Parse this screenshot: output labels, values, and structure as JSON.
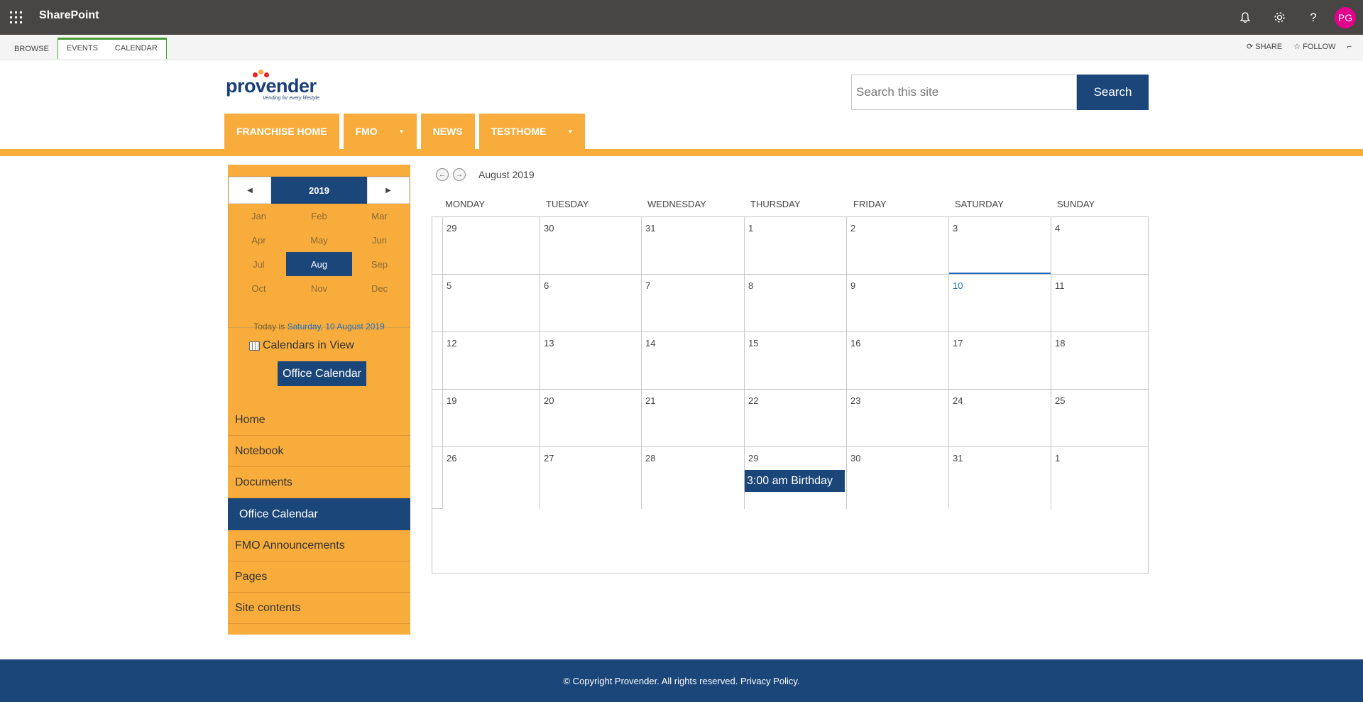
{
  "suite": {
    "brand": "SharePoint",
    "avatar_initials": "PG",
    "avatar_color": "#e3008c",
    "icons": [
      "bell-icon",
      "gear-icon",
      "help-icon"
    ]
  },
  "ribbon": {
    "browse": "BROWSE",
    "events": "EVENTS",
    "calendar": "CALENDAR",
    "share": "SHARE",
    "follow": "FOLLOW"
  },
  "logo": {
    "text": "provender",
    "tagline": "Vending for every lifestyle"
  },
  "search": {
    "placeholder": "Search this site",
    "button": "Search"
  },
  "topnav": {
    "items": [
      {
        "label": "FRANCHISE HOME"
      },
      {
        "label": "FMO"
      },
      {
        "label": "NEWS"
      },
      {
        "label": "TESTHOME"
      }
    ]
  },
  "datepicker": {
    "year": "2019",
    "months": [
      "Jan",
      "Feb",
      "Mar",
      "Apr",
      "May",
      "Jun",
      "Jul",
      "Aug",
      "Sep",
      "Oct",
      "Nov",
      "Dec"
    ],
    "selected_month": "Aug",
    "today_prefix": "Today is ",
    "today_link": "Saturday, 10 August 2019"
  },
  "calendars_in_view": {
    "label": "Calendars in View",
    "calendar_button": "Office Calendar"
  },
  "quicklaunch": {
    "items": [
      {
        "label": "Home"
      },
      {
        "label": "Notebook"
      },
      {
        "label": "Documents"
      },
      {
        "label": "Office Calendar",
        "selected": true
      },
      {
        "label": "FMO Announcements"
      },
      {
        "label": "Pages"
      },
      {
        "label": "Site contents"
      }
    ]
  },
  "calendar": {
    "month_title": "August 2019",
    "weekdays": [
      "MONDAY",
      "TUESDAY",
      "WEDNESDAY",
      "THURSDAY",
      "FRIDAY",
      "SATURDAY",
      "SUNDAY"
    ],
    "weeks": [
      [
        "29",
        "30",
        "31",
        "1",
        "2",
        "3",
        "4"
      ],
      [
        "5",
        "6",
        "7",
        "8",
        "9",
        "10",
        "11"
      ],
      [
        "12",
        "13",
        "14",
        "15",
        "16",
        "17",
        "18"
      ],
      [
        "19",
        "20",
        "21",
        "22",
        "23",
        "24",
        "25"
      ],
      [
        "26",
        "27",
        "28",
        "29",
        "30",
        "31",
        "1"
      ]
    ],
    "today": "10",
    "event": {
      "label": "3:00 am Birthday",
      "date": "29"
    }
  },
  "footer": {
    "text": "© Copyright Provender. All rights reserved. Privacy Policy."
  },
  "colors": {
    "suite_bar": "#484644",
    "brand_blue": "#1b4679",
    "accent_orange": "#f8ac3c",
    "link_blue": "#1e6cbf"
  }
}
